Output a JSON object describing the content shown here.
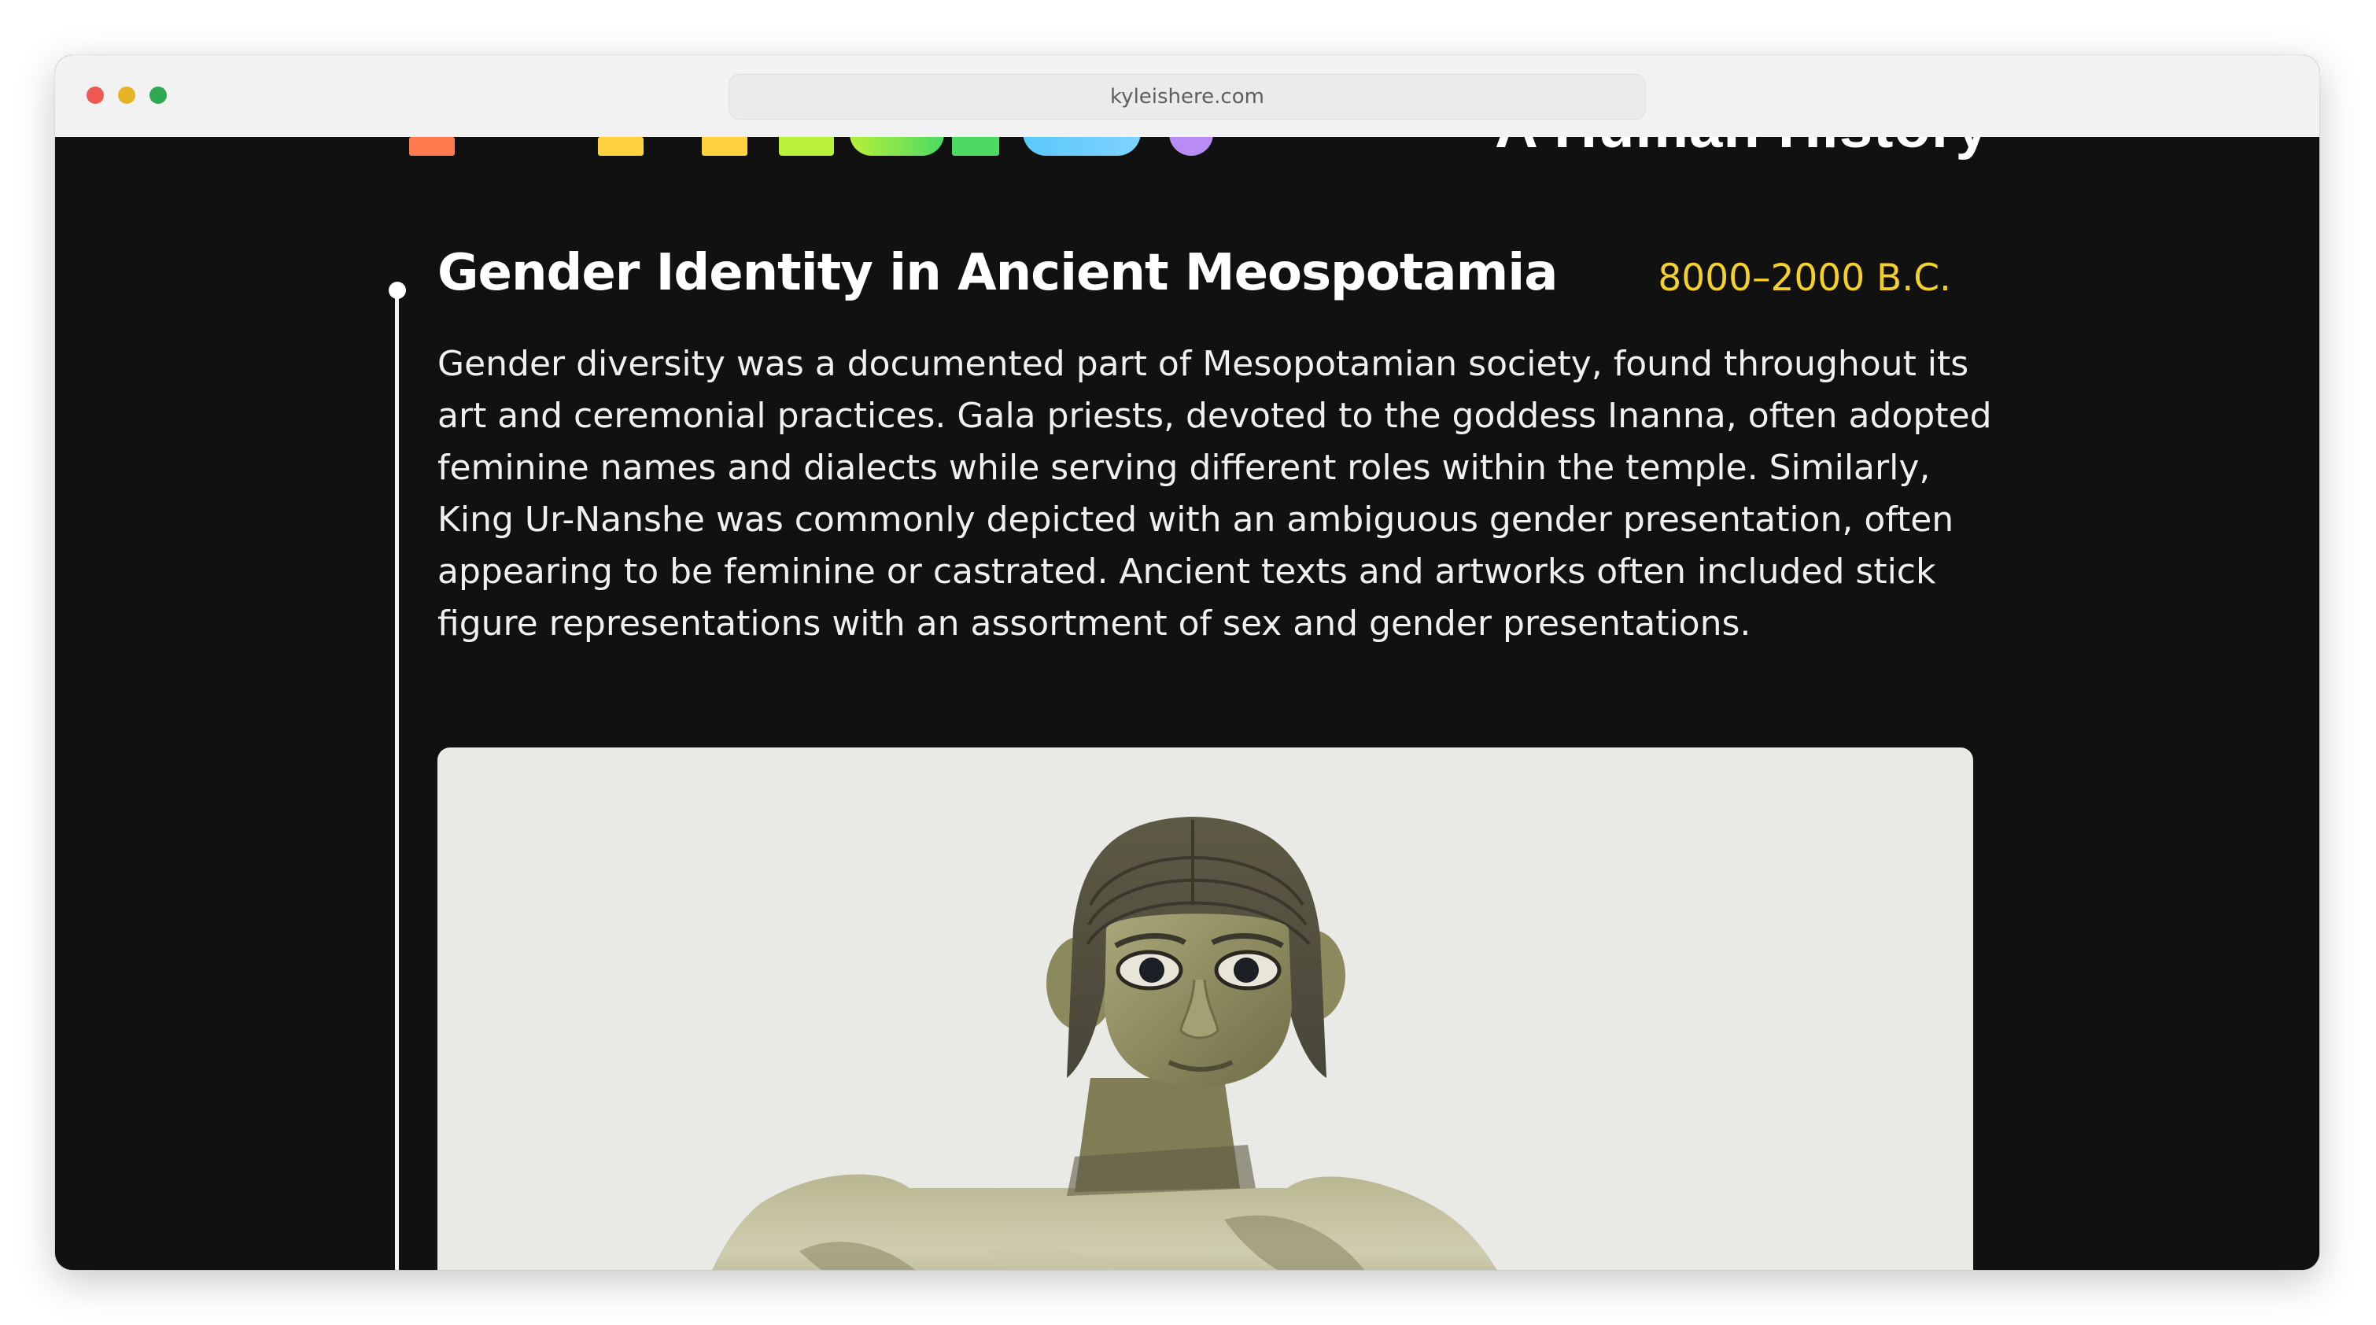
{
  "browser": {
    "url": "kyleishere.com"
  },
  "colors": {
    "page_background": "#111111",
    "heading": "#ffffff",
    "date_accent": "#f5cf2a",
    "timeline": "#f4f4f4",
    "logo_gradient": [
      "#ff7a4d",
      "#ffd23f",
      "#b8f03a",
      "#4cd964",
      "#5ac8fa",
      "#b98cf5"
    ]
  },
  "header": {
    "logo_label": "pride-wordmark",
    "subtitle": "A Human History"
  },
  "entry": {
    "title": "Gender Identity in Ancient Meospotamia",
    "date": "8000–2000 B.C.",
    "body": "Gender diversity was a documented part of Mesopotamian society, found throughout its art and ceremonial practices. Gala priests, devoted to the goddess Inanna, often adopted feminine names and dialects while serving different roles within the temple. Similarly, King Ur-Nanshe was commonly depicted with an ambiguous gender presentation, often appearing to be feminine or castrated. Ancient texts and artworks often included stick figure representations with an assortment of sex and gender presentations.",
    "image_subject": "statue-of-king-ur-nanshe"
  }
}
